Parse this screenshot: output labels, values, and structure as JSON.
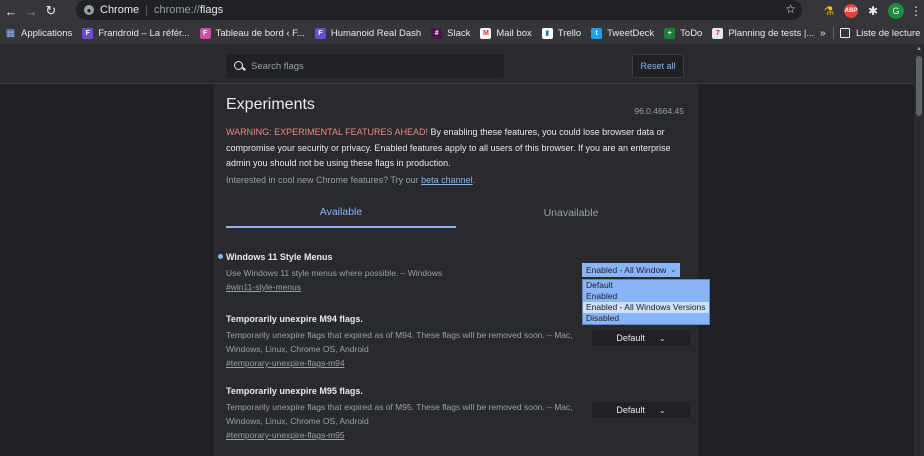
{
  "toolbar": {
    "site_name": "Chrome",
    "url_scheme": "chrome://",
    "url_path": "flags"
  },
  "extensions": {
    "abp_label": "ABP",
    "avatar_initial": "G"
  },
  "bookmarks": {
    "items": [
      {
        "label": "Applications",
        "icon": "apps-grid-icon"
      },
      {
        "label": "Frandroid – La référ...",
        "icon": "frandroid-icon"
      },
      {
        "label": "Tableau de bord ‹ F...",
        "icon": "tableau-icon"
      },
      {
        "label": "Humanoid Real Dash",
        "icon": "humanoid-icon"
      },
      {
        "label": "Slack",
        "icon": "slack-icon"
      },
      {
        "label": "Mail box",
        "icon": "mail-icon"
      },
      {
        "label": "Trello",
        "icon": "trello-icon"
      },
      {
        "label": "TweetDeck",
        "icon": "tweetdeck-icon"
      },
      {
        "label": "ToDo",
        "icon": "todo-icon"
      },
      {
        "label": "Planning de tests |...",
        "icon": "planning-icon"
      }
    ],
    "more_label": "»",
    "reading_list_label": "Liste de lecture"
  },
  "header": {
    "search_placeholder": "Search flags",
    "reset_label": "Reset all"
  },
  "main": {
    "title": "Experiments",
    "version": "96.0.4664.45",
    "warning_red": "WARNING: EXPERIMENTAL FEATURES AHEAD!",
    "warning_rest": " By enabling these features, you could lose browser data or compromise your security or privacy. Enabled features apply to all users of this browser. If you are an enterprise admin you should not be using these flags in production.",
    "interest_text": "Interested in cool new Chrome features? Try our ",
    "interest_link": "beta channel",
    "interest_end": ".",
    "tabs": {
      "available": "Available",
      "unavailable": "Unavailable"
    }
  },
  "flags": [
    {
      "title": "Windows 11 Style Menus",
      "description": "Use Windows 11 style menus where possible. – Windows",
      "link": "#win11-style-menus",
      "value": "Enabled - All Window"
    },
    {
      "title": "Temporarily unexpire M94 flags.",
      "description": "Temporarily unexpire flags that expired as of M94. These flags will be removed soon. – Mac, Windows, Linux, Chrome OS, Android",
      "link": "#temporary-unexpire-flags-m94",
      "value": "Default"
    },
    {
      "title": "Temporarily unexpire M95 flags.",
      "description": "Temporarily unexpire flags that expired as of M95. These flags will be removed soon. – Mac, Windows, Linux, Chrome OS, Android",
      "link": "#temporary-unexpire-flags-m95",
      "value": "Default"
    }
  ],
  "dropdown": {
    "options": [
      "Default",
      "Enabled",
      "Enabled - All Windows Versions",
      "Disabled"
    ]
  }
}
